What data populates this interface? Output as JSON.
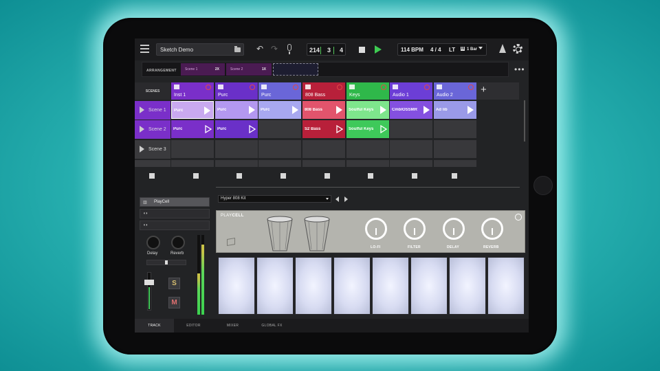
{
  "topbar": {
    "project_name": "Sketch Demo",
    "undo_glyph": "↶",
    "redo_glyph": "↷",
    "position": {
      "bar": "214",
      "beat": "3",
      "tick": "4"
    },
    "tempo": "114 BPM",
    "signature": "4 / 4",
    "lt_label": "LT",
    "lt_badge": "III",
    "loop_length": "1 Bar"
  },
  "arrangement": {
    "label": "ARRANGEMENT",
    "segments": [
      {
        "name": "Scene 1",
        "repeat": "2X"
      },
      {
        "name": "Scene 2",
        "repeat": "1X"
      }
    ],
    "more_glyph": "•••"
  },
  "scenes_header": "SCENES",
  "tracks": [
    {
      "name": "Inst 1",
      "color": "#7a2fc9"
    },
    {
      "name": "Purc",
      "color": "#6a30c8"
    },
    {
      "name": "Purc",
      "color": "#6a66d8"
    },
    {
      "name": "808 Bass",
      "color": "#b8203a"
    },
    {
      "name": "Keys",
      "color": "#2fb84a"
    },
    {
      "name": "Audio 1",
      "color": "#6c3ed6"
    },
    {
      "name": "Audio 2",
      "color": "#6a66d8"
    }
  ],
  "add_track_glyph": "+",
  "scenes": [
    {
      "name": "Scene 1"
    },
    {
      "name": "Scene 2"
    },
    {
      "name": "Scene 3"
    }
  ],
  "clips_row1": [
    {
      "name": "Purc",
      "color": "#c9a9f0"
    },
    {
      "name": "Purc",
      "color": "#b398f0"
    },
    {
      "name": "Purc",
      "color": "#a8a8f0"
    },
    {
      "name": "808 Bass",
      "color": "#e2546c"
    },
    {
      "name": "Soulful Keys",
      "color": "#7ee68c"
    },
    {
      "name": "CmbIOSSMR",
      "color": "#8450e0"
    },
    {
      "name": "Ad lib",
      "color": "#9a9ae8"
    }
  ],
  "clips_row2": [
    {
      "name": "Purc",
      "color": "#7a2fc9"
    },
    {
      "name": "Purc",
      "color": "#6a30c8"
    },
    {
      "name": "S2 Bass",
      "color": "#b8203a"
    },
    {
      "name": "Soulful Keys",
      "color": "#3ec95a"
    }
  ],
  "left_panel": {
    "items": [
      {
        "icon": "▥",
        "label": "PlayCell"
      },
      {
        "icon": "◖◗",
        "label": ""
      },
      {
        "icon": "◖◗",
        "label": ""
      }
    ],
    "knob_delay": "Delay",
    "knob_reverb": "Reverb",
    "solo": "S",
    "mute": "M"
  },
  "device": {
    "kit": "Hyper 808 Kit",
    "title_light": "PLAY",
    "title_bold": "CELL",
    "knobs": [
      "LO-FI",
      "FILTER",
      "DELAY",
      "REVERB"
    ]
  },
  "tabs": [
    "TRACK",
    "EDITOR",
    "MIXER",
    "GLOBAL FX"
  ],
  "colors": {
    "accent_green": "#3ecb52",
    "scene_purple": "#7a2fc9"
  }
}
